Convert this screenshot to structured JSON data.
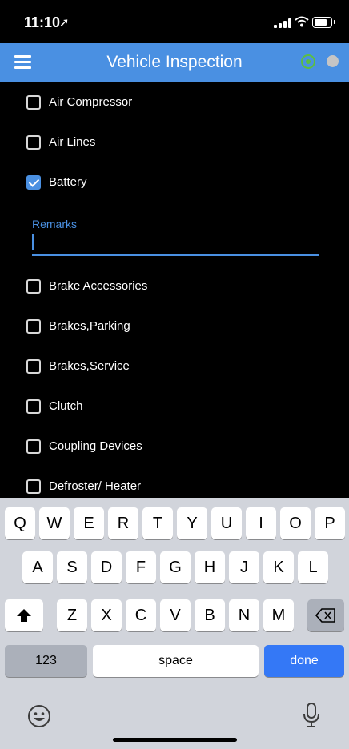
{
  "status_bar": {
    "time": "11:10",
    "location_icon": "location-arrow-icon"
  },
  "app_bar": {
    "title": "Vehicle Inspection",
    "menu_icon": "hamburger-menu-icon",
    "gps_icon": "gps-target-icon",
    "status_dot_color": "#c5c5c5"
  },
  "accent_color": "#4a90e2",
  "items": [
    {
      "label": "Air Compressor",
      "checked": false
    },
    {
      "label": "Air Lines",
      "checked": false
    },
    {
      "label": "Battery",
      "checked": true
    },
    {
      "label": "Brake Accessories",
      "checked": false
    },
    {
      "label": "Brakes,Parking",
      "checked": false
    },
    {
      "label": "Brakes,Service",
      "checked": false
    },
    {
      "label": "Clutch",
      "checked": false
    },
    {
      "label": "Coupling Devices",
      "checked": false
    },
    {
      "label": "Defroster/ Heater",
      "checked": false
    }
  ],
  "remarks": {
    "label": "Remarks",
    "value": ""
  },
  "keyboard": {
    "row1": [
      "Q",
      "W",
      "E",
      "R",
      "T",
      "Y",
      "U",
      "I",
      "O",
      "P"
    ],
    "row2": [
      "A",
      "S",
      "D",
      "F",
      "G",
      "H",
      "J",
      "K",
      "L"
    ],
    "row3": [
      "Z",
      "X",
      "C",
      "V",
      "B",
      "N",
      "M"
    ],
    "numbers_label": "123",
    "space_label": "space",
    "done_label": "done"
  }
}
